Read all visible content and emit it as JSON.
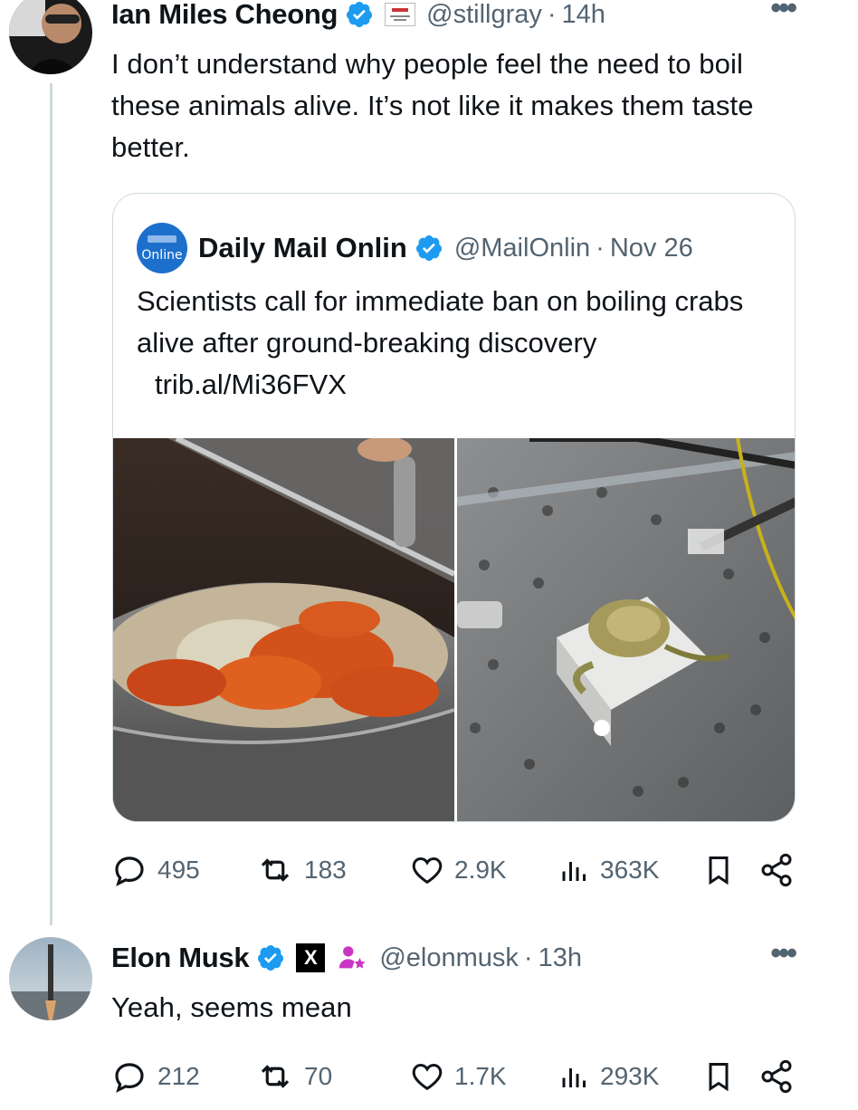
{
  "tweet": {
    "author_name": "Ian Miles Cheong",
    "handle": "@stillgray",
    "separator": "·",
    "time": "14h",
    "more": "•••",
    "text": "I don’t understand why people feel the need to boil these animals alive. It’s not like it makes them taste better.",
    "quoted": {
      "logo_text": "Online",
      "author_name": "Daily Mail Onlin",
      "handle": "@MailOnlin",
      "separator": "·",
      "date": "Nov 26",
      "text": "Scientists call for immediate ban on boiling crabs alive after ground-breaking discovery",
      "link": "trib.al/Mi36FVX"
    },
    "stats": {
      "replies": "495",
      "retweets": "183",
      "likes": "2.9K",
      "views": "363K"
    }
  },
  "reply": {
    "author_name": "Elon Musk",
    "affiliate_badge": "X",
    "handle": "@elonmusk",
    "separator": "·",
    "time": "13h",
    "more": "•••",
    "text": "Yeah, seems mean",
    "stats": {
      "replies": "212",
      "retweets": "70",
      "likes": "1.7K",
      "views": "293K"
    }
  },
  "colors": {
    "verified": "#1d9bf0",
    "muted": "#536471",
    "border": "#cfd9de",
    "brand_logo": "#1d6fcc"
  },
  "icons": [
    "verified-badge-icon",
    "reply-icon",
    "retweet-icon",
    "like-icon",
    "views-icon",
    "bookmark-icon",
    "share-icon",
    "subscriber-icon"
  ]
}
